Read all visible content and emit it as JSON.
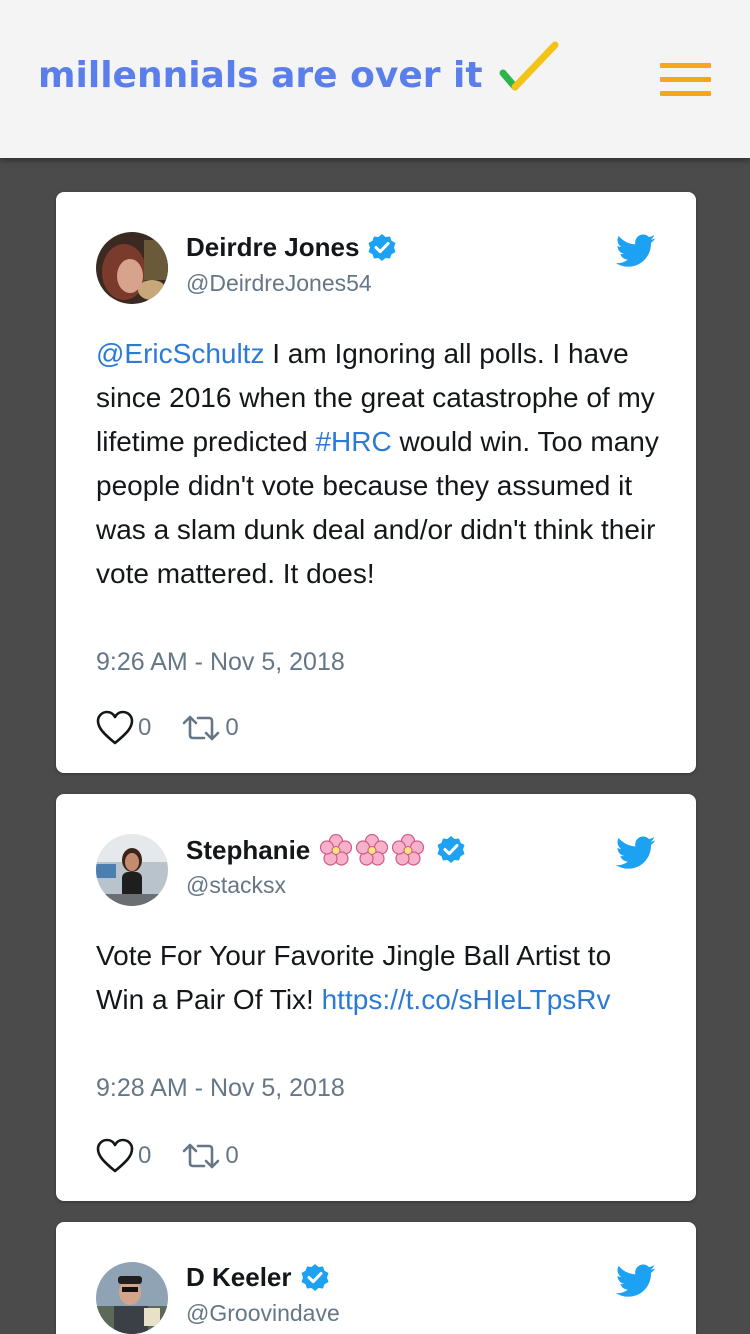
{
  "header": {
    "title": "millennials are over it",
    "check_colors": [
      "#2fb34a",
      "#f3c316"
    ],
    "menu_icon": "hamburger-icon",
    "menu_color": "#f7a51c"
  },
  "tweets": [
    {
      "name": "Deirdre Jones",
      "handle": "@DeirdreJones54",
      "text": [
        {
          "t": "@EricSchultz",
          "link": true
        },
        {
          "t": " I am Ignoring all polls. I have since 2016 when the great catastrophe of my lifetime predicted ",
          "link": false
        },
        {
          "t": "#HRC",
          "link": true
        },
        {
          "t": " would win. Too many people didn't vote because they assumed it was a slam dunk deal and/or didn't think their vote mattered. It does!",
          "link": false
        }
      ],
      "timestamp": "9:26 AM - Nov 5, 2018",
      "likes": "0",
      "retweets": "0"
    },
    {
      "name": "Stephanie",
      "emojis": [
        "cherry-blossom",
        "cherry-blossom",
        "cherry-blossom"
      ],
      "handle": "@stacksx",
      "text": [
        {
          "t": "Vote For Your Favorite Jingle Ball Artist to Win a Pair Of Tix! ",
          "link": false
        },
        {
          "t": "https://t.co/sHIeLTpsRv",
          "link": true
        }
      ],
      "timestamp": "9:28 AM - Nov 5, 2018",
      "likes": "0",
      "retweets": "0"
    },
    {
      "name": "D Keeler",
      "handle": "@Groovindave"
    }
  ]
}
